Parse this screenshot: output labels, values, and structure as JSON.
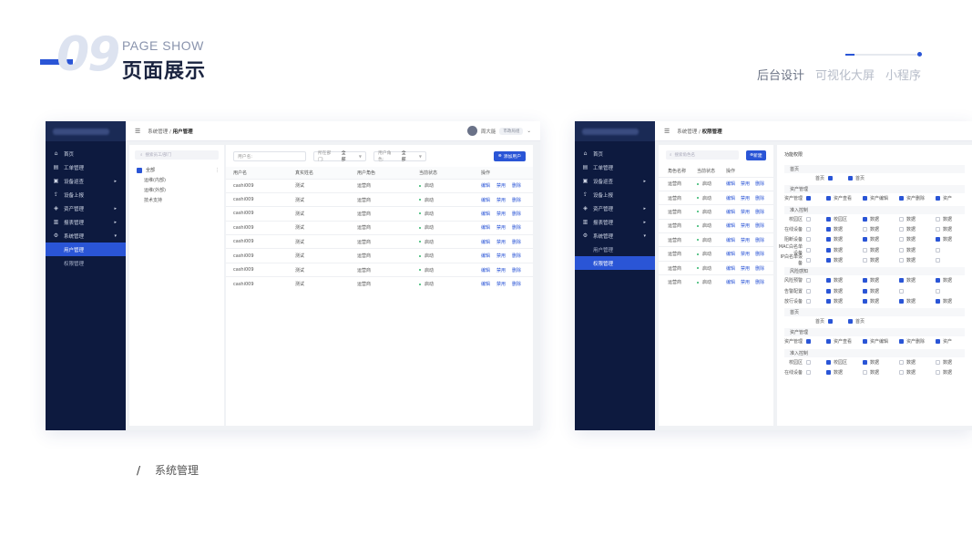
{
  "header": {
    "number": "09",
    "title_en": "PAGE SHOW",
    "title_cn": "页面展示",
    "tabs": [
      {
        "label": "后台设计",
        "active": true
      },
      {
        "label": "可视化大屏",
        "active": false
      },
      {
        "label": "小程序",
        "active": false
      }
    ],
    "progress_fraction": 0.12
  },
  "caption": {
    "slash": "/",
    "text": "系统管理"
  },
  "colors": {
    "accent": "#2a55d6",
    "sidebar": "#0d1a3f",
    "status_green": "#2fb56b"
  },
  "sidebar": {
    "items": [
      {
        "icon": "home-icon",
        "label": "首页",
        "has_arrow": false
      },
      {
        "icon": "work-order-icon",
        "label": "工单管理",
        "has_arrow": false
      },
      {
        "icon": "inspection-icon",
        "label": "设备巡查",
        "has_arrow": true
      },
      {
        "icon": "upload-icon",
        "label": "设备上报",
        "has_arrow": false
      },
      {
        "icon": "asset-icon",
        "label": "资产管理",
        "has_arrow": true
      },
      {
        "icon": "report-icon",
        "label": "报表管理",
        "has_arrow": true
      },
      {
        "icon": "gear-icon",
        "label": "系统管理",
        "has_arrow": true
      }
    ],
    "sub_items": [
      "用户管理",
      "权限管理"
    ]
  },
  "screen1": {
    "breadcrumb_parent": "系统管理",
    "breadcrumb_sep": " / ",
    "breadcrumb_current": "用户管理",
    "user_name": "周大能",
    "user_tag": "市政局组",
    "dept_search_placeholder": "搜索员工/部门",
    "dept_tree": [
      {
        "label": "全部",
        "level": 0,
        "checked": true
      },
      {
        "label": "运维(内部)",
        "level": 1
      },
      {
        "label": "运维(外部)",
        "level": 1
      },
      {
        "label": "技术支持",
        "level": 1
      }
    ],
    "filters": [
      {
        "label": "用户名:",
        "value": ""
      },
      {
        "label": "所在部门:",
        "value": "全部"
      },
      {
        "label": "用户角色:",
        "value": "全部"
      }
    ],
    "add_button": "添加用户",
    "columns": [
      "用户名",
      "真实姓名",
      "用户角色",
      "当前状态",
      "操作"
    ],
    "rows": [
      {
        "user": "cashi009",
        "real": "测试",
        "role": "运营商",
        "status": "启动"
      },
      {
        "user": "cashi009",
        "real": "测试",
        "role": "运营商",
        "status": "启动"
      },
      {
        "user": "cashi009",
        "real": "测试",
        "role": "运营商",
        "status": "启动"
      },
      {
        "user": "cashi009",
        "real": "测试",
        "role": "运营商",
        "status": "启动"
      },
      {
        "user": "cashi009",
        "real": "测试",
        "role": "运营商",
        "status": "启动"
      },
      {
        "user": "cashi009",
        "real": "测试",
        "role": "运营商",
        "status": "启动"
      },
      {
        "user": "cashi009",
        "real": "测试",
        "role": "运营商",
        "status": "启动"
      },
      {
        "user": "cashi009",
        "real": "测试",
        "role": "运营商",
        "status": "启动"
      }
    ],
    "actions": [
      "编辑",
      "禁用",
      "删除"
    ]
  },
  "screen2": {
    "breadcrumb_parent": "系统管理",
    "breadcrumb_sep": " / ",
    "breadcrumb_current": "权限管理",
    "role_search_placeholder": "搜索角色名",
    "new_button": "新建",
    "columns": [
      "角色名称",
      "当前状态",
      "操作"
    ],
    "rows": [
      {
        "role": "运营商",
        "status": "启动"
      },
      {
        "role": "运营商",
        "status": "启动"
      },
      {
        "role": "运营商",
        "status": "启动"
      },
      {
        "role": "运营商",
        "status": "启动"
      },
      {
        "role": "运营商",
        "status": "启动"
      },
      {
        "role": "运营商",
        "status": "启动"
      },
      {
        "role": "运营商",
        "status": "启动"
      },
      {
        "role": "运营商",
        "status": "启动"
      }
    ],
    "actions": [
      "编辑",
      "禁用",
      "删除"
    ],
    "perm_title": "功能权限",
    "sections": [
      {
        "title": "首页",
        "rows": [
          {
            "name": "首页",
            "on": true,
            "cells": [
              {
                "label": "首页",
                "on": true
              }
            ]
          }
        ]
      },
      {
        "title": "资产管理",
        "rows": [
          {
            "name": "资产管理",
            "on": true,
            "cells": [
              {
                "label": "资产查看",
                "on": true
              },
              {
                "label": "资产编辑",
                "on": true
              },
              {
                "label": "资产删除",
                "on": true
              },
              {
                "label": "资产",
                "on": true
              }
            ]
          }
        ]
      },
      {
        "title": "准入控制",
        "rows": [
          {
            "name": "校园区",
            "on": false,
            "cells": [
              {
                "label": "校园区",
                "on": true
              },
              {
                "label": "数据",
                "on": true
              },
              {
                "label": "数据",
                "on": false
              },
              {
                "label": "数据",
                "on": false
              }
            ]
          },
          {
            "name": "在线设备",
            "on": false,
            "cells": [
              {
                "label": "数据",
                "on": true
              },
              {
                "label": "数据",
                "on": false
              },
              {
                "label": "数据",
                "on": false
              },
              {
                "label": "数据",
                "on": false
              }
            ]
          },
          {
            "name": "阻断设备",
            "on": false,
            "cells": [
              {
                "label": "数据",
                "on": true
              },
              {
                "label": "数据",
                "on": true
              },
              {
                "label": "数据",
                "on": false
              },
              {
                "label": "数据",
                "on": true
              }
            ]
          },
          {
            "name": "MAC白名单设备",
            "on": false,
            "cells": [
              {
                "label": "数据",
                "on": true
              },
              {
                "label": "数据",
                "on": false
              },
              {
                "label": "数据",
                "on": false
              },
              {
                "label": "",
                "on": false
              }
            ]
          },
          {
            "name": "IP白名单设备",
            "on": false,
            "cells": [
              {
                "label": "数据",
                "on": true
              },
              {
                "label": "数据",
                "on": false
              },
              {
                "label": "数据",
                "on": false
              },
              {
                "label": "",
                "on": false
              }
            ]
          }
        ]
      },
      {
        "title": "风险感知",
        "rows": [
          {
            "name": "风险预警",
            "on": false,
            "cells": [
              {
                "label": "数据",
                "on": true
              },
              {
                "label": "数据",
                "on": true
              },
              {
                "label": "数据",
                "on": true
              },
              {
                "label": "数据",
                "on": true
              }
            ]
          },
          {
            "name": "告警配置",
            "on": false,
            "cells": [
              {
                "label": "数据",
                "on": true
              },
              {
                "label": "数据",
                "on": true
              },
              {
                "label": "",
                "on": false
              },
              {
                "label": "",
                "on": false
              }
            ]
          },
          {
            "name": "放行设备",
            "on": false,
            "cells": [
              {
                "label": "数据",
                "on": true
              },
              {
                "label": "数据",
                "on": true
              },
              {
                "label": "数据",
                "on": true
              },
              {
                "label": "数据",
                "on": true
              }
            ]
          }
        ]
      },
      {
        "title": "首页",
        "rows": [
          {
            "name": "首页",
            "on": true,
            "cells": [
              {
                "label": "首页",
                "on": true
              }
            ]
          }
        ]
      },
      {
        "title": "资产管理",
        "rows": [
          {
            "name": "资产管理",
            "on": true,
            "cells": [
              {
                "label": "资产查看",
                "on": true
              },
              {
                "label": "资产编辑",
                "on": true
              },
              {
                "label": "资产删除",
                "on": true
              },
              {
                "label": "资产",
                "on": true
              }
            ]
          }
        ]
      },
      {
        "title": "准入控制",
        "rows": [
          {
            "name": "校园区",
            "on": false,
            "cells": [
              {
                "label": "校园区",
                "on": true
              },
              {
                "label": "数据",
                "on": true
              },
              {
                "label": "数据",
                "on": false
              },
              {
                "label": "数据",
                "on": false
              }
            ]
          },
          {
            "name": "在线设备",
            "on": false,
            "cells": [
              {
                "label": "数据",
                "on": true
              },
              {
                "label": "数据",
                "on": false
              },
              {
                "label": "数据",
                "on": false
              },
              {
                "label": "数据",
                "on": false
              }
            ]
          }
        ]
      }
    ]
  }
}
